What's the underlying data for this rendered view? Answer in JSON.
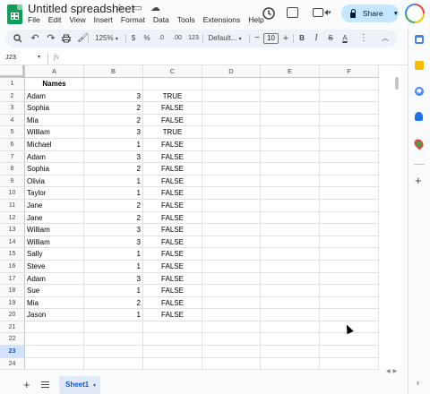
{
  "app": {
    "doc_title": "Untitled spreadsheet",
    "menus": [
      "File",
      "Edit",
      "View",
      "Insert",
      "Format",
      "Data",
      "Tools",
      "Extensions",
      "Help"
    ],
    "share_label": "Share"
  },
  "toolbar": {
    "zoom": "125%",
    "currency": "$",
    "percent": "%",
    "decrease_decimal": ".0",
    "increase_decimal": ".00",
    "number_format": "123",
    "font": "Default...",
    "font_size": "10",
    "minus": "−",
    "plus": "+",
    "bold": "B",
    "italic": "I",
    "strike": "S",
    "text_color": "A",
    "more": "⋮",
    "collapse": "︿"
  },
  "formula_bar": {
    "name_box": "J23",
    "fx": "fx",
    "content": ""
  },
  "sheet": {
    "columns": [
      "A",
      "B",
      "C",
      "D",
      "E",
      "F"
    ],
    "selected_row": 23,
    "rows": [
      {
        "n": "1",
        "a": "Names",
        "b": "",
        "c": ""
      },
      {
        "n": "2",
        "a": "Adam",
        "b": "3",
        "c": "TRUE"
      },
      {
        "n": "3",
        "a": "Sophia",
        "b": "2",
        "c": "FALSE"
      },
      {
        "n": "4",
        "a": "Mia",
        "b": "2",
        "c": "FALSE"
      },
      {
        "n": "5",
        "a": "William",
        "b": "3",
        "c": "TRUE"
      },
      {
        "n": "6",
        "a": "Michael",
        "b": "1",
        "c": "FALSE"
      },
      {
        "n": "7",
        "a": "Adam",
        "b": "3",
        "c": "FALSE"
      },
      {
        "n": "8",
        "a": "Sophia",
        "b": "2",
        "c": "FALSE"
      },
      {
        "n": "9",
        "a": "Olivia",
        "b": "1",
        "c": "FALSE"
      },
      {
        "n": "10",
        "a": "Taylor",
        "b": "1",
        "c": "FALSE"
      },
      {
        "n": "11",
        "a": "Jane",
        "b": "2",
        "c": "FALSE"
      },
      {
        "n": "12",
        "a": "Jane",
        "b": "2",
        "c": "FALSE"
      },
      {
        "n": "13",
        "a": "William",
        "b": "3",
        "c": "FALSE"
      },
      {
        "n": "14",
        "a": "William",
        "b": "3",
        "c": "FALSE"
      },
      {
        "n": "15",
        "a": "Sally",
        "b": "1",
        "c": "FALSE"
      },
      {
        "n": "16",
        "a": "Steve",
        "b": "1",
        "c": "FALSE"
      },
      {
        "n": "17",
        "a": "Adam",
        "b": "3",
        "c": "FALSE"
      },
      {
        "n": "18",
        "a": "Sue",
        "b": "1",
        "c": "FALSE"
      },
      {
        "n": "19",
        "a": "Mia",
        "b": "2",
        "c": "FALSE"
      },
      {
        "n": "20",
        "a": "Jason",
        "b": "1",
        "c": "FALSE"
      },
      {
        "n": "21",
        "a": "",
        "b": "",
        "c": ""
      },
      {
        "n": "22",
        "a": "",
        "b": "",
        "c": ""
      },
      {
        "n": "23",
        "a": "",
        "b": "",
        "c": ""
      },
      {
        "n": "24",
        "a": "",
        "b": "",
        "c": ""
      }
    ]
  },
  "bottom": {
    "add_sheet": "+",
    "sheet_tab": "Sheet1",
    "sheet_tab_caret": "▾"
  },
  "colors": {
    "brand_green": "#0f9d58",
    "share_bg": "#c2e7ff",
    "selection_blue": "#0b57d0",
    "tab_bg": "#e1e9f7"
  }
}
